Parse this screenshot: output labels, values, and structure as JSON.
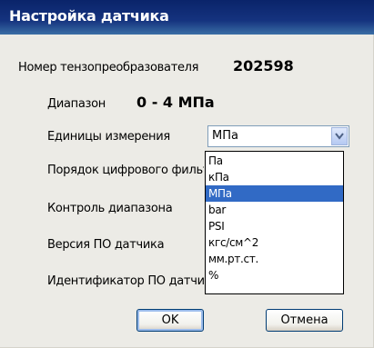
{
  "window": {
    "title": "Настройка датчика"
  },
  "fields": {
    "sensor_number_label": "Номер тензопреобразователя",
    "sensor_number_value": "202598",
    "range_label": "Диапазон",
    "range_value": "0 - 4 МПа",
    "units_label": "Единицы измерения",
    "filter_label": "Порядок цифрового фильтра",
    "range_control_label": "Контроль диапазона",
    "firmware_version_label": "Версия ПО датчика",
    "firmware_id_label": "Идентификатор ПО датчика"
  },
  "units_select": {
    "selected": "МПа",
    "options": [
      "Па",
      "кПа",
      "МПа",
      "bar",
      "PSI",
      "кгс/см^2",
      "мм.рт.ст.",
      "%"
    ],
    "highlighted_index": 2
  },
  "buttons": {
    "ok": "OK",
    "cancel": "Отмена"
  },
  "colors": {
    "titlebar": "#0a246a",
    "selection": "#316ac5",
    "dialog_bg": "#ecebe6"
  }
}
